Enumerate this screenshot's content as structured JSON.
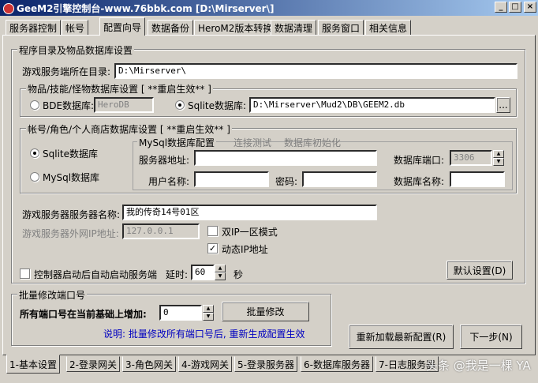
{
  "window": {
    "title": "GeeM2引擎控制台-www.76bbk.com [D:\\Mirserver\\]",
    "minimize": "_",
    "maximize": "□",
    "close": "×"
  },
  "tabs": [
    "服务器控制",
    "帐号",
    "配置向导",
    "数据备份",
    "HeroM2版本转换",
    "数据清理",
    "服务窗口",
    "相关信息"
  ],
  "config": {
    "group_title": "程序目录及物品数据库设置",
    "server_dir_label": "游戏服务端所在目录:",
    "server_dir_value": "D:\\Mirserver\\",
    "db_group_title": "物品/技能/怪物数据库设置 [ **重启生效** ]",
    "bde_label": "BDE数据库:",
    "bde_value": "HeroDB",
    "sqlite_label": "Sqlite数据库:",
    "sqlite_value": "D:\\Mirserver\\Mud2\\DB\\GEEM2.db",
    "browse": "...",
    "account_group_title": "帐号/角色/个人商店数据库设置  [ **重启生效** ]",
    "sqlite_option": "Sqlite数据库",
    "mysql_option": "MySql数据库",
    "mysql_config_label": "MySql数据库配置",
    "test_conn": "连接测试",
    "init_db": "数据库初始化",
    "server_addr_label": "服务器地址:",
    "server_addr_value": "",
    "port_label": "数据库端口:",
    "port_value": "3306",
    "user_label": "用户名称:",
    "user_value": "",
    "pwd_label": "密码:",
    "pwd_value": "",
    "dbname_label": "数据库名称:",
    "dbname_value": "",
    "game_server_name_label": "游戏服务器服务器名称:",
    "game_server_name_value": "我的传奇14号01区",
    "ext_ip_label": "游戏服务器外网IP地址:",
    "ext_ip_value": "127.0.0.1",
    "dual_ip_label": "双IP一区模式",
    "dual_ip_checked": false,
    "dynamic_ip_label": "动态IP地址",
    "dynamic_ip_checked": true,
    "autostart_label": "控制器启动后自动启动服务端",
    "autostart_checked": false,
    "delay_label": "延时:",
    "delay_value": "60",
    "seconds_label": "秒",
    "default_btn": "默认设置(D)"
  },
  "ports": {
    "group_title": "批量修改端口号",
    "increase_label": "所有端口号在当前基础上增加:",
    "increase_value": "0",
    "batch_btn": "批量修改",
    "note": "说明: 批量修改所有端口号后, 重新生成配置生效"
  },
  "actions": {
    "reload_btn": "重新加载最新配置(R)",
    "next_btn": "下一步(N)"
  },
  "bottom_tabs": [
    "1-基本设置",
    "2-登录网关",
    "3-角色网关",
    "4-游戏网关",
    "5-登录服务器",
    "6-数据库服务器",
    "7-日志服务器"
  ],
  "watermark": "头条 @我是一棵 YA"
}
